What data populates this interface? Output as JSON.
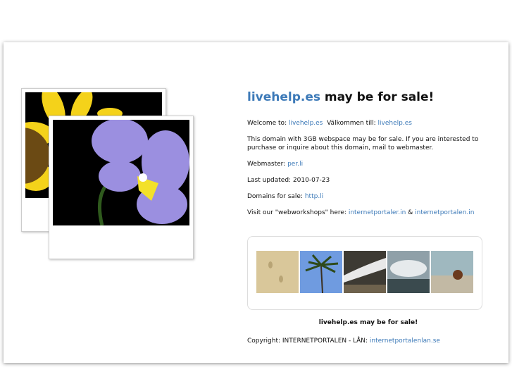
{
  "header": {
    "domain": "livehelp.es",
    "title_rest": " may be for sale!"
  },
  "welcome": {
    "label": "Welcome to: ",
    "link1": "livehelp.es",
    "label2": "  Välkommen till: ",
    "link2": "livehelp.es"
  },
  "description": "This domain with 3GB webspace may be for sale. If you are interested to purchase or inquire about this domain, mail to webmaster.",
  "webmaster": {
    "label": "Webmaster: ",
    "link": "per.li"
  },
  "last_updated": {
    "label": "Last updated: ",
    "value": "2010-07-23"
  },
  "domains_for_sale": {
    "label": "Domains for sale: ",
    "link": "http.li"
  },
  "workshops": {
    "label": "Visit our \"webworkshops\" here: ",
    "link1": "internetportaler.in",
    "sep": " & ",
    "link2": "internetportalen.in"
  },
  "footer_title": "livehelp.es may be for sale!",
  "copyright": {
    "label": "Copyright: INTERNETPORTALEN - LÅN: ",
    "link": "internetportalenlan.se"
  },
  "colors": {
    "link": "#3d7ab8"
  }
}
